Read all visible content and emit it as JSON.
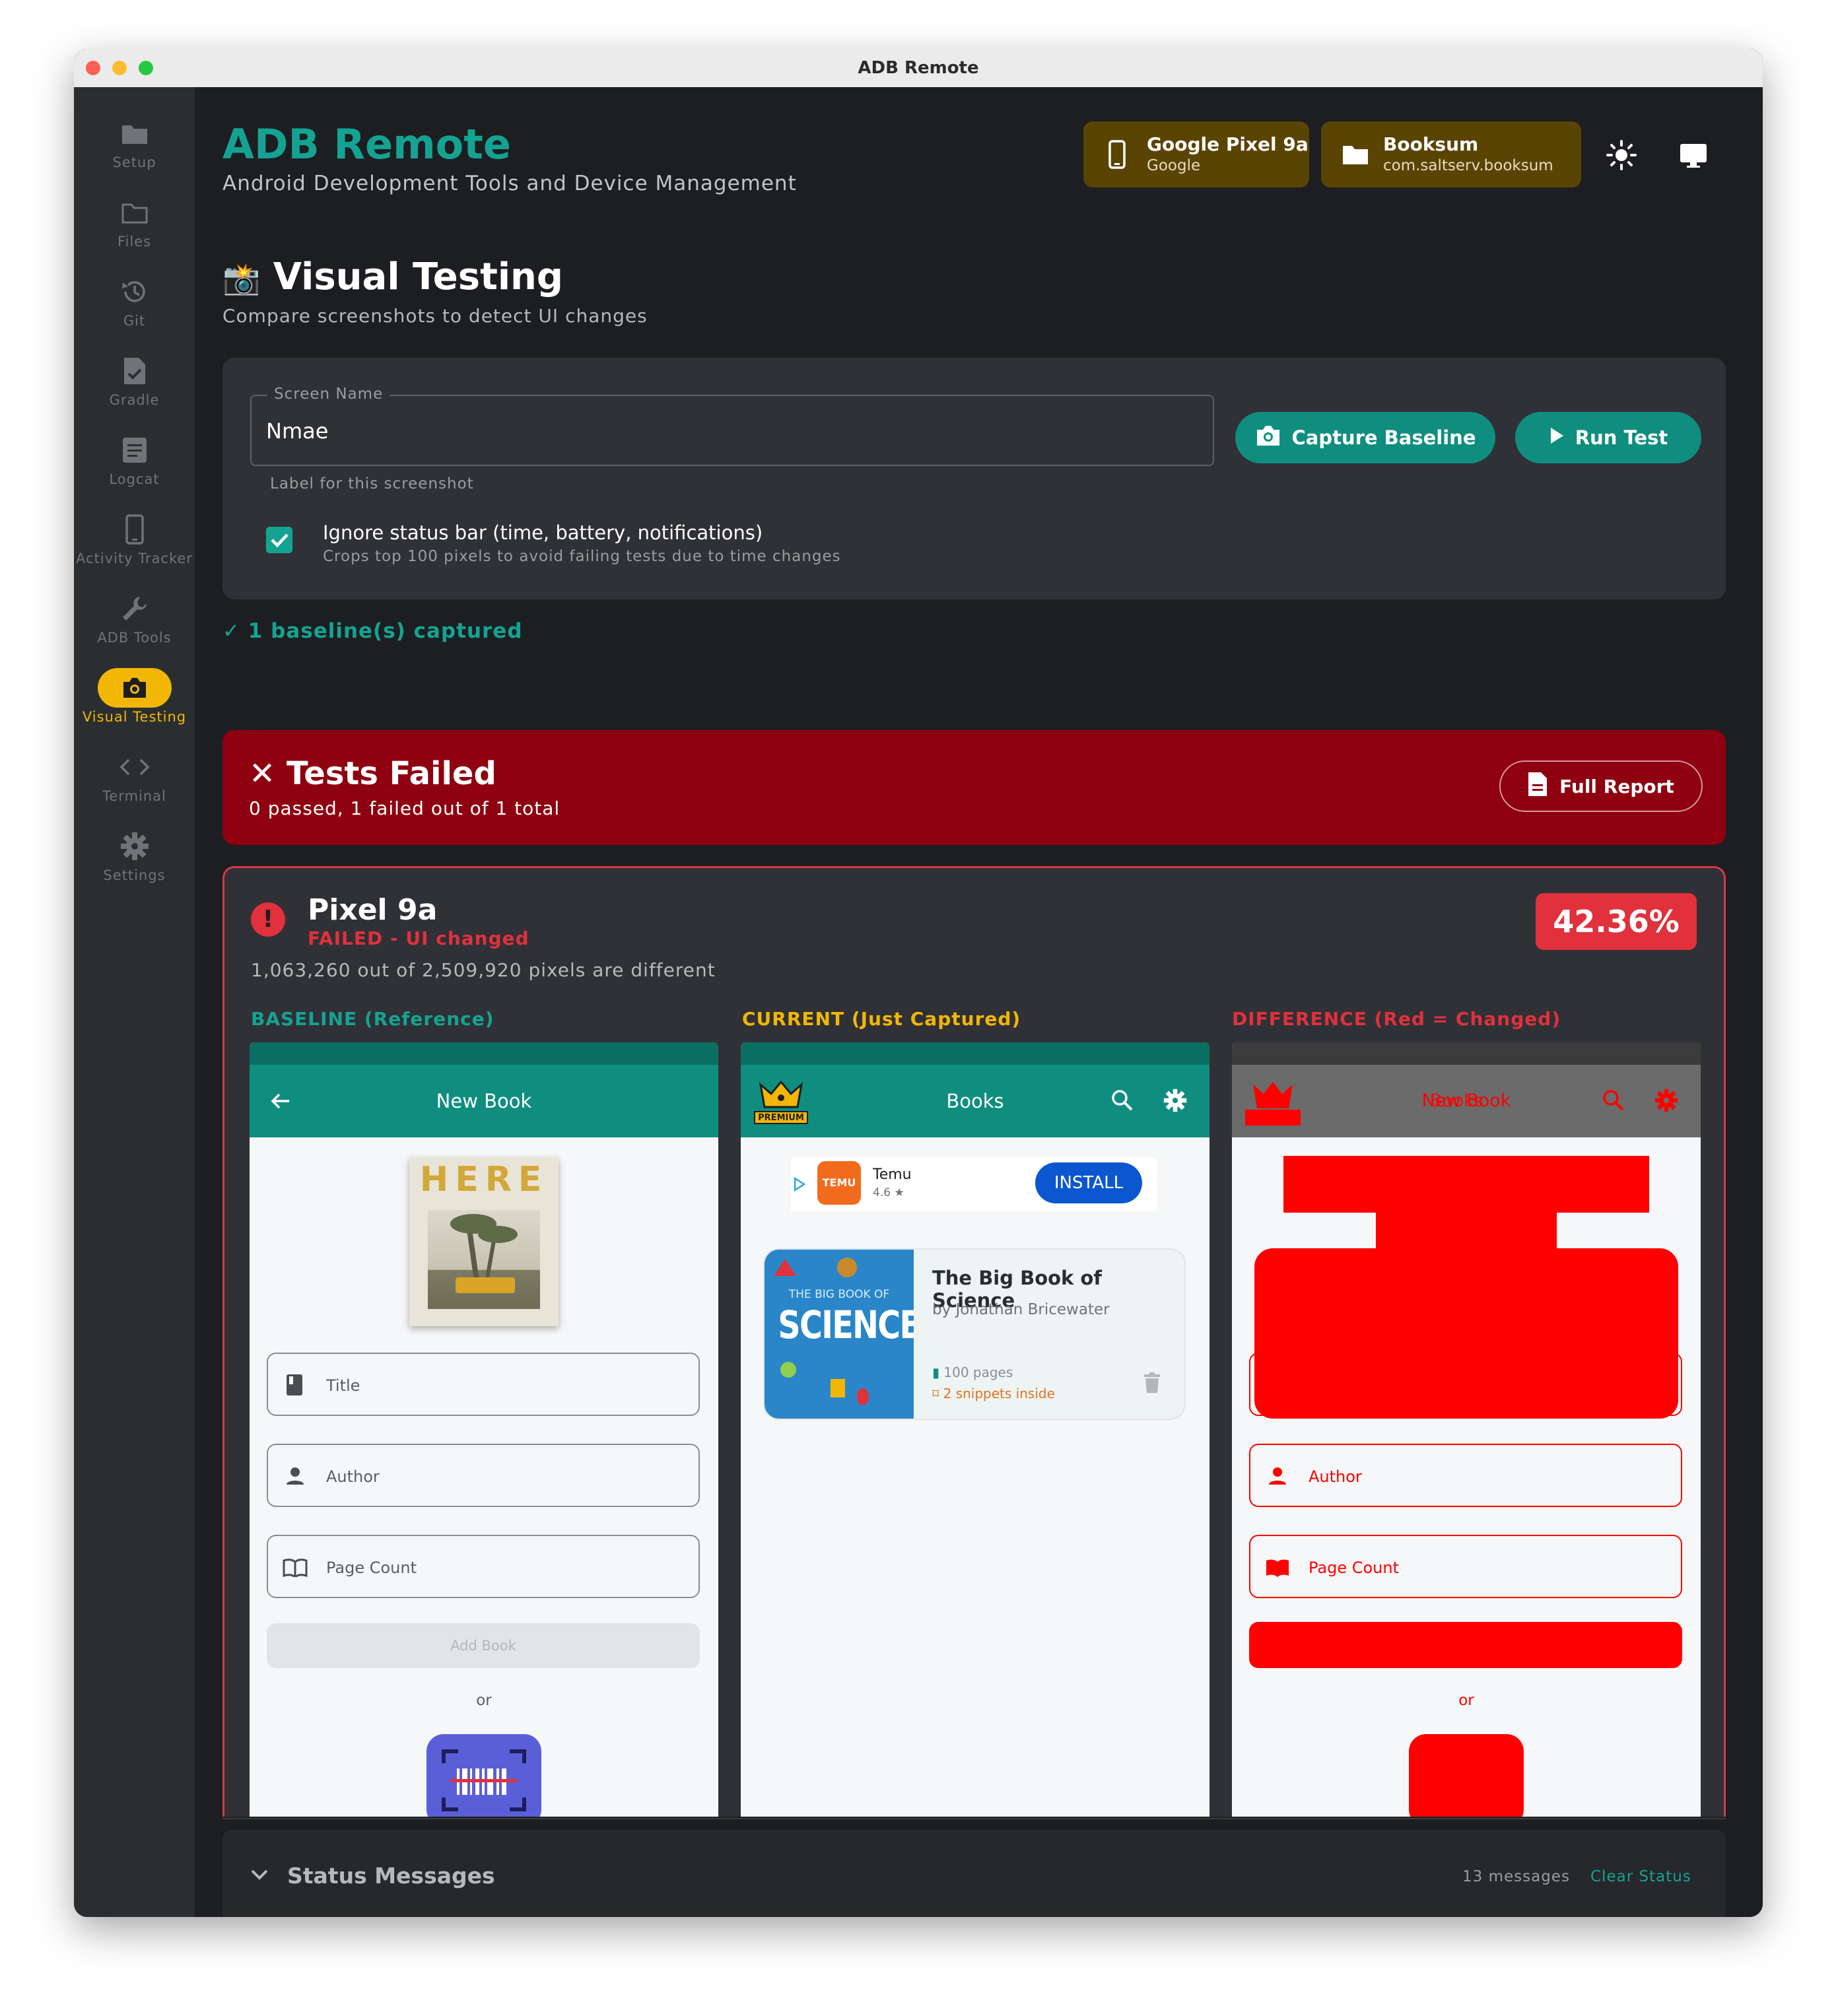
{
  "window": {
    "title": "ADB Remote"
  },
  "sidebar": {
    "items": [
      {
        "label": "Setup",
        "icon": "folder-icon"
      },
      {
        "label": "Files",
        "icon": "folder-outline-icon"
      },
      {
        "label": "Git",
        "icon": "history-icon"
      },
      {
        "label": "Gradle",
        "icon": "file-check-icon"
      },
      {
        "label": "Logcat",
        "icon": "document-lines-icon"
      },
      {
        "label": "Activity Tracker",
        "icon": "phone-icon"
      },
      {
        "label": "ADB Tools",
        "icon": "wrench-icon"
      },
      {
        "label": "Visual Testing",
        "icon": "camera-icon",
        "active": true
      },
      {
        "label": "Terminal",
        "icon": "code-icon"
      },
      {
        "label": "Settings",
        "icon": "gear-icon"
      }
    ]
  },
  "header": {
    "title": "ADB Remote",
    "subtitle": "Android Development Tools and Device Management",
    "device": {
      "name": "Google Pixel 9a",
      "maker": "Google"
    },
    "project": {
      "name": "Booksum",
      "package": "com.saltserv.booksum"
    }
  },
  "page": {
    "title": "Visual Testing",
    "subtitle": "Compare screenshots to detect UI changes"
  },
  "form": {
    "screen_name_label": "Screen Name",
    "screen_name_value": "Nmae",
    "helper": "Label for this screenshot",
    "capture_label": "Capture Baseline",
    "run_label": "Run Test",
    "ignore_label": "Ignore status bar (time, battery, notifications)",
    "ignore_sub": "Crops top 100 pixels to avoid failing tests due to time changes",
    "ignore_checked": true
  },
  "baseline_status": "✓ 1 baseline(s) captured",
  "results": {
    "title": "✕ Tests Failed",
    "summary": "0 passed, 1 failed out of 1 total",
    "report_label": "Full Report"
  },
  "test": {
    "device": "Pixel 9a",
    "status": "FAILED - UI changed",
    "percent": "42.36%",
    "detail": "1,063,260 out of 2,509,920 pixels are different",
    "baseline_label": "BASELINE (Reference)",
    "current_label": "CURRENT (Just Captured)",
    "diff_label": "DIFFERENCE (Red = Changed)"
  },
  "baseline_screen": {
    "title": "New Book",
    "cover_text": "HERE",
    "fields": [
      "Title",
      "Author",
      "Page Count"
    ],
    "button": "Add Book",
    "or": "or"
  },
  "current_screen": {
    "title": "Books",
    "premium": "PREMIUM",
    "ad": {
      "name": "Temu",
      "rating": "4.6 ★",
      "cta": "INSTALL",
      "logo": "TEMU"
    },
    "book": {
      "title": "The Big Book of Science",
      "author": "by Jonathan Bricewater",
      "pages": "100 pages",
      "snippets": "2 snippets inside",
      "cover_top": "THE BIG BOOK OF",
      "cover_main": "SCIENCE"
    }
  },
  "diff_screen": {
    "title_a": "New Book",
    "title_b": "Books",
    "fields": [
      "Author",
      "Page Count"
    ],
    "or": "or"
  },
  "status_panel": {
    "title": "Status Messages",
    "count": "13 messages",
    "clear": "Clear Status"
  },
  "colors": {
    "accent": "#14a393",
    "teal_button": "#0f8e80",
    "fail_red": "#8f0010",
    "diff_red": "#ff0000",
    "current_yellow": "#f2b705",
    "chip_bg": "#5a4403"
  }
}
